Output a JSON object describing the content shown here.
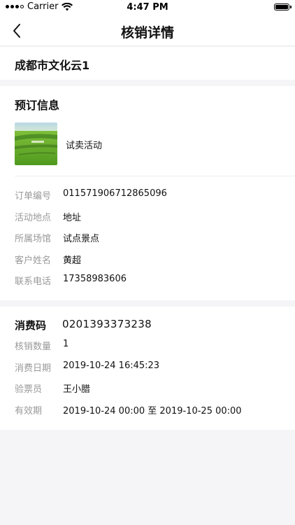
{
  "status_bar": {
    "carrier": "Carrier",
    "time": "4:47 PM"
  },
  "nav": {
    "title": "核销详情",
    "back_icon": "chevron-left-icon"
  },
  "org": {
    "name": "成都市文化云1"
  },
  "booking": {
    "title": "预订信息",
    "activity_name": "试卖活动",
    "rows": [
      {
        "label": "订单编号",
        "value": "011571906712865096"
      },
      {
        "label": "活动地点",
        "value": "地址"
      },
      {
        "label": "所属场馆",
        "value": "试点景点"
      },
      {
        "label": "客户姓名",
        "value": "黄超"
      },
      {
        "label": "联系电话",
        "value": "17358983606"
      }
    ]
  },
  "consume": {
    "code_label": "消费码",
    "code_value": "0201393373238",
    "rows": [
      {
        "label": "核销数量",
        "value": "1"
      },
      {
        "label": "消费日期",
        "value": "2019-10-24 16:45:23"
      },
      {
        "label": "验票员",
        "value": "王小腊"
      },
      {
        "label": "有效期",
        "value": "2019-10-24 00:00 至 2019-10-25 00:00"
      }
    ]
  }
}
